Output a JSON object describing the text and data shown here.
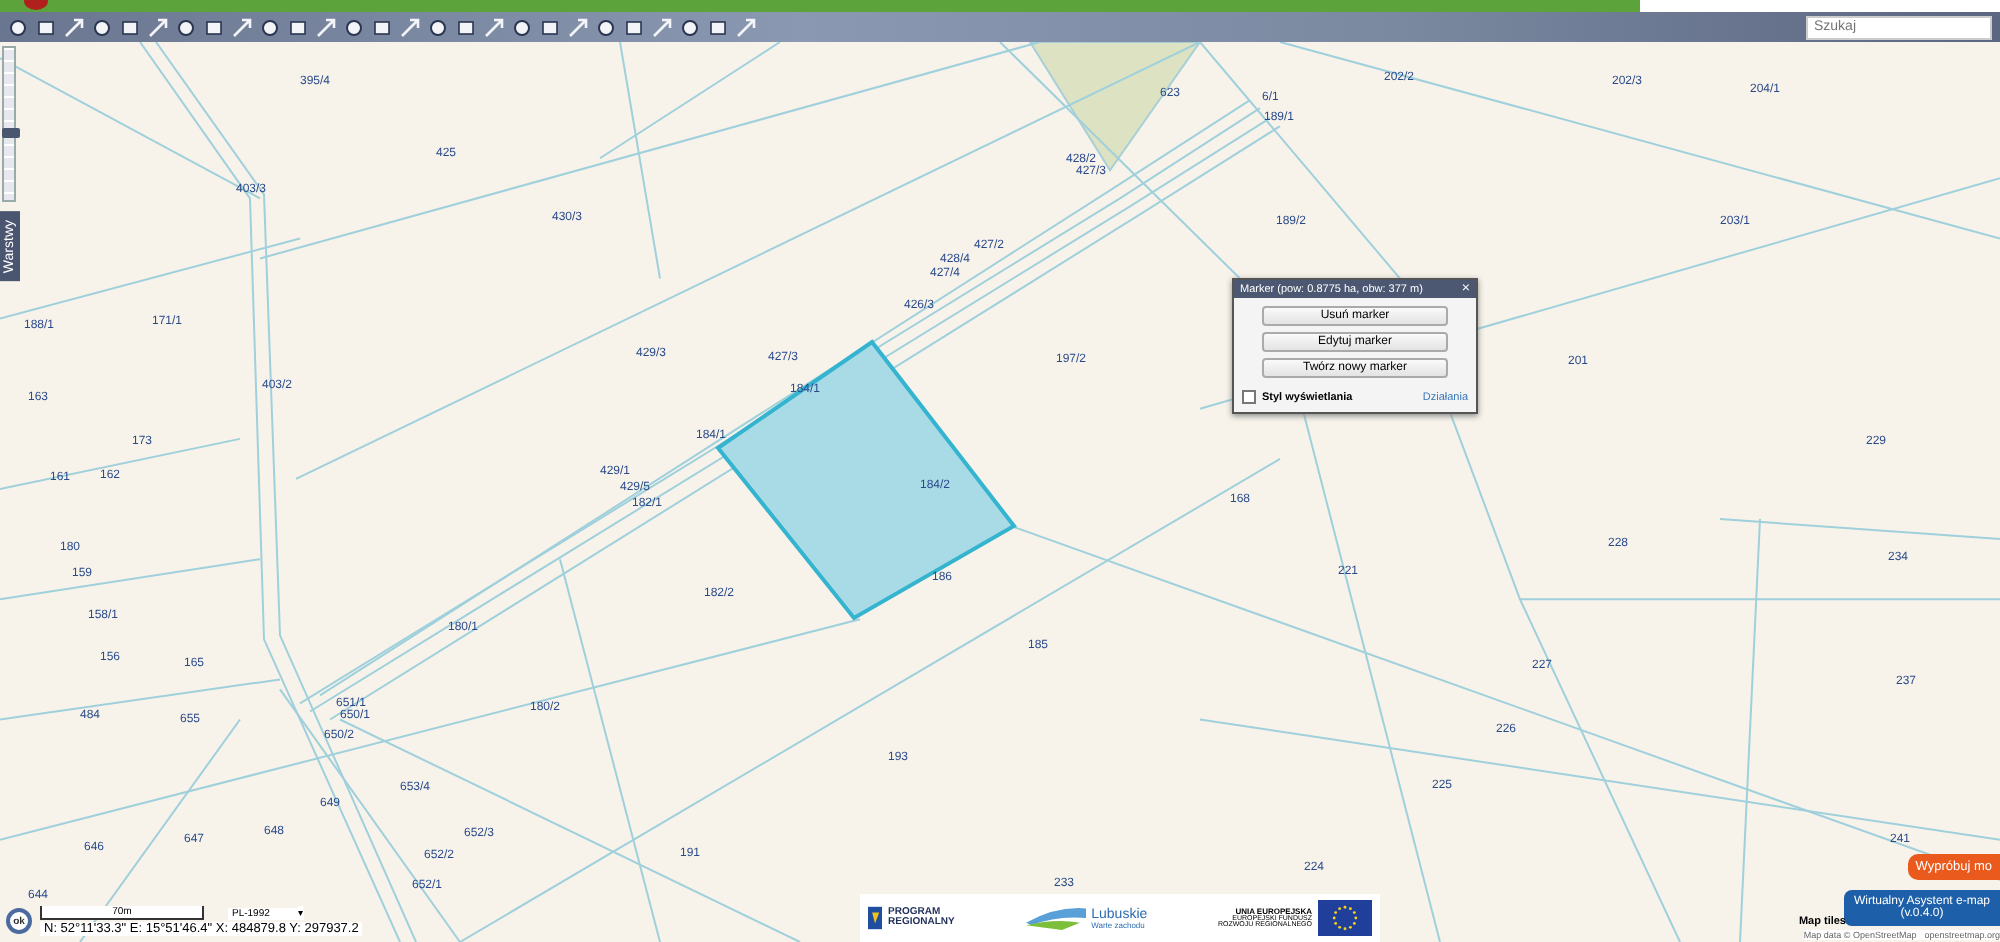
{
  "toolbar": {
    "search": {
      "placeholder": "Szukaj"
    }
  },
  "side_tab": {
    "label": "Warstwy"
  },
  "zoom_slider": {
    "level": 0.45
  },
  "parcels": [
    "395/4",
    "425",
    "403/3",
    "430/3",
    "623",
    "6/1",
    "202/2",
    "202/3",
    "204/1",
    "189/1",
    "428/2",
    "427/3",
    "189/2",
    "203/1",
    "427/2",
    "428/4",
    "427/4",
    "426/3",
    "197/2",
    "201",
    "188/1",
    "171/1",
    "403/2",
    "429/3",
    "427/3",
    "184/1",
    "163",
    "184/1",
    "229",
    "173",
    "161",
    "162",
    "429/1",
    "429/5",
    "182/1",
    "184/2",
    "168",
    "228",
    "234",
    "180",
    "159",
    "158/1",
    "156",
    "165",
    "180/1",
    "182/2",
    "186",
    "221",
    "185",
    "227",
    "237",
    "484",
    "655",
    "651/1",
    "650/1",
    "650/2",
    "180/2",
    "226",
    "193",
    "225",
    "653/4",
    "649",
    "647",
    "648",
    "646",
    "652/3",
    "652/2",
    "652/1",
    "191",
    "224",
    "233",
    "241",
    "644"
  ],
  "popup": {
    "title": "Marker (pow: 0.8775 ha, obw: 377 m)",
    "close": "×",
    "buttons": [
      "Usuń marker",
      "Edytuj marker",
      "Twórz nowy marker"
    ],
    "style_option": {
      "label": "Styl wyświetlania",
      "checked": false
    },
    "link": "Działania"
  },
  "status": {
    "ok_button": "ok",
    "scale": "70m",
    "projection": "PL-1992",
    "projection_caret": "▾",
    "coordinates": "N: 52°11'33.3\"  E: 15°51'46.4\"  X: 484879.8  Y: 297937.2"
  },
  "logos": {
    "program": [
      "PROGRAM",
      "REGIONALNY"
    ],
    "region": "Lubuskie",
    "region_slogan": "Warte zachodu",
    "eu": [
      "UNIA EUROPEJSKA",
      "EUROPEJSKI FUNDUSZ",
      "ROZWOJU REGIONALNEGO"
    ]
  },
  "try_button": "Wypróbuj mo",
  "assistant_button": [
    "Wirtualny Asystent e-map",
    "(v.0.4.0)"
  ],
  "attribution": {
    "tiles": "Map tiles",
    "data": "Map data © OpenStreetMap",
    "link": "openstreetmap.org"
  }
}
